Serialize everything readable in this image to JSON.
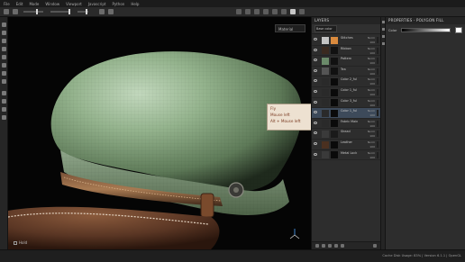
{
  "menu": [
    "File",
    "Edit",
    "Mode",
    "Window",
    "Viewport",
    "Javascript",
    "Python",
    "Help"
  ],
  "viewport": {
    "display_select": "Material",
    "mode_label": "Hold"
  },
  "tooltip": {
    "line1": "Fly",
    "line2": "Mouse left",
    "line3": "Alt + Mouse left"
  },
  "layers_panel": {
    "title": "LAYERS",
    "display_select": "Base color",
    "layers": [
      {
        "name": "Stitches",
        "blend": "Norm",
        "opacity": "100",
        "thumb": "#c4c4c4",
        "mask": "#d98a3e",
        "mask_fill": "#222"
      },
      {
        "name": "Ribbon",
        "blend": "Norm",
        "opacity": "100",
        "thumb": "#3a2a20",
        "mask": "#111111"
      },
      {
        "name": "Pattern",
        "blend": "Norm",
        "opacity": "100",
        "thumb": "#6b8a6a",
        "mask": "#111111"
      },
      {
        "name": "Tea",
        "blend": "Norm",
        "opacity": "100",
        "thumb": "#555555",
        "mask": "#111111"
      },
      {
        "name": "Color 2_ful",
        "blend": "Norm",
        "opacity": "100",
        "thumb": "#2a2a2a",
        "mask": "#0a0a0a"
      },
      {
        "name": "Color 1_ful",
        "blend": "Norm",
        "opacity": "100",
        "thumb": "#2a2a2a",
        "mask": "#0a0a0a"
      },
      {
        "name": "Color 3_ful",
        "blend": "Norm",
        "opacity": "100",
        "thumb": "#2a2a2a",
        "mask": "#0a0a0a"
      },
      {
        "name": "Color 1_ful",
        "blend": "Norm",
        "opacity": "100",
        "thumb": "#2a2a2a",
        "mask": "#0a0a0a",
        "active": true
      },
      {
        "name": "Fabric Main",
        "blend": "Norm",
        "opacity": "100",
        "thumb": "#2a2a2a",
        "mask": "#0a0a0a"
      },
      {
        "name": "Shead",
        "blend": "Norm",
        "opacity": "100",
        "thumb": "#3a3a3a",
        "mask": "#1a1a1a"
      },
      {
        "name": "Leather",
        "blend": "Norm",
        "opacity": "100",
        "thumb": "#4a3020",
        "mask": "#0a0a0a"
      },
      {
        "name": "Metal Lock",
        "blend": "Norm",
        "opacity": "100",
        "thumb": "#3a3a3a",
        "mask": "#0a0a0a"
      }
    ]
  },
  "properties_panel": {
    "title": "PROPERTIES - POLYGON FILL",
    "color_label": "Color"
  },
  "status": {
    "text": "Cache Disk Usage: 83% | Version 6.1.1 | OpenGL"
  },
  "colors": {
    "cap_green": "#8aa983",
    "leather": "#5a3624",
    "active_layer": "#3d4a5a"
  }
}
